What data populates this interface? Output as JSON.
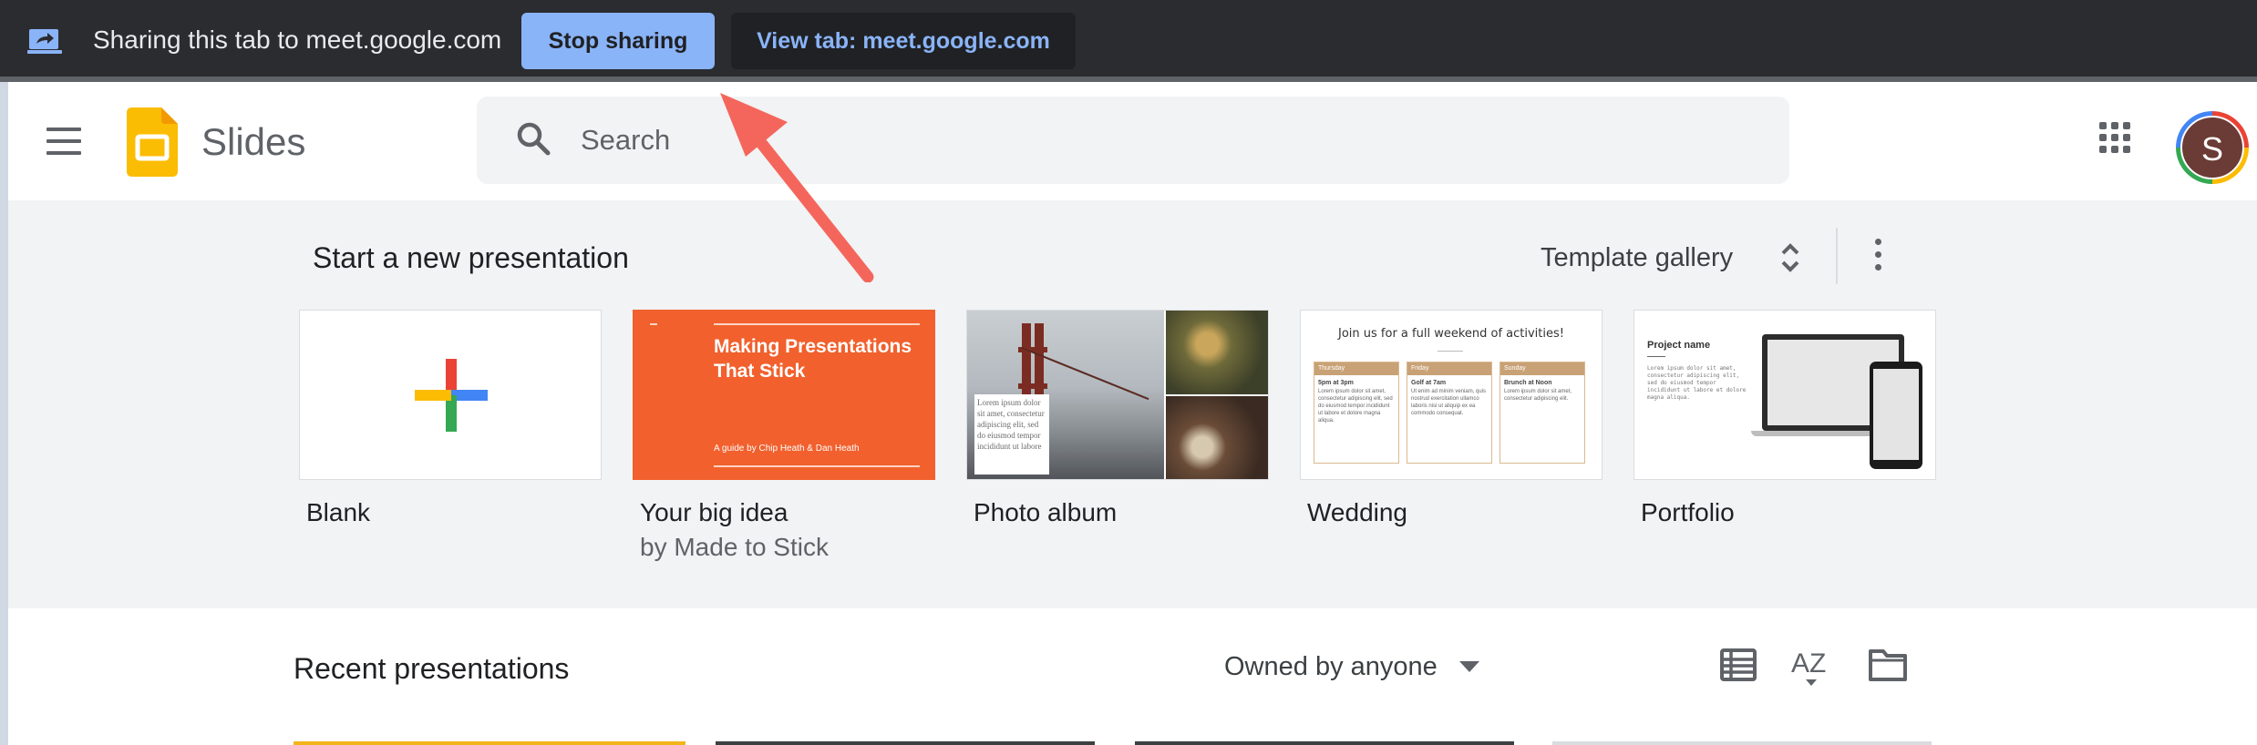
{
  "share_bar": {
    "message": "Sharing this tab to meet.google.com",
    "stop_label": "Stop sharing",
    "view_label": "View tab: meet.google.com",
    "icon": "screen-share-icon"
  },
  "header": {
    "app_name": "Slides",
    "search_placeholder": "Search",
    "avatar_initial": "S",
    "icons": [
      "menu-icon",
      "slides-logo",
      "search-icon",
      "apps-grid-icon"
    ]
  },
  "templates": {
    "heading": "Start a new presentation",
    "gallery_label": "Template gallery",
    "items": [
      {
        "label": "Blank",
        "sub": ""
      },
      {
        "label": "Your big idea",
        "sub": "by Made to Stick"
      },
      {
        "label": "Photo album",
        "sub": ""
      },
      {
        "label": "Wedding",
        "sub": ""
      },
      {
        "label": "Portfolio",
        "sub": ""
      }
    ],
    "big_idea_thumb": {
      "title": "Making Presentations That Stick",
      "byline": "A guide by Chip Heath & Dan Heath"
    },
    "photo_thumb": {
      "caption": "Lorem ipsum dolor sit amet, consectetur adipiscing elit, sed do eiusmod tempor incididunt ut labore"
    },
    "wedding_thumb": {
      "title": "Join us for a full weekend of activities!",
      "days": [
        {
          "day": "Thursday",
          "time": "5pm at 3pm",
          "text": "Lorem ipsum dolor sit amet, consectetur adipiscing elit, sed do eiusmod tempor incididunt ut labore et dolore magna aliqua."
        },
        {
          "day": "Friday",
          "time": "Golf at 7am",
          "text": "Ut enim ad minim veniam, quis nostrud exercitation ullamco laboris nisi ut aliquip ex ea commodo consequat."
        },
        {
          "day": "Sunday",
          "time": "Brunch at Noon",
          "text": "Lorem ipsum dolor sit amet, consectetur adipiscing elit."
        }
      ]
    },
    "portfolio_thumb": {
      "title": "Project name",
      "text": "Lorem ipsum dolor sit amet, consectetur adipiscing elit, sed do eiusmod tempor incididunt ut labore et dolore magna aliqua."
    }
  },
  "recent": {
    "heading": "Recent presentations",
    "owner_filter": "Owned by anyone",
    "icons": [
      "list-view-icon",
      "sort-az-icon",
      "folder-icon"
    ]
  },
  "colors": {
    "share_bar_bg": "#2b2c30",
    "stop_button": "#8ab4f8",
    "annotation_arrow": "#f4665c",
    "slides_yellow": "#fbbc04",
    "big_idea_orange": "#f1602d"
  }
}
